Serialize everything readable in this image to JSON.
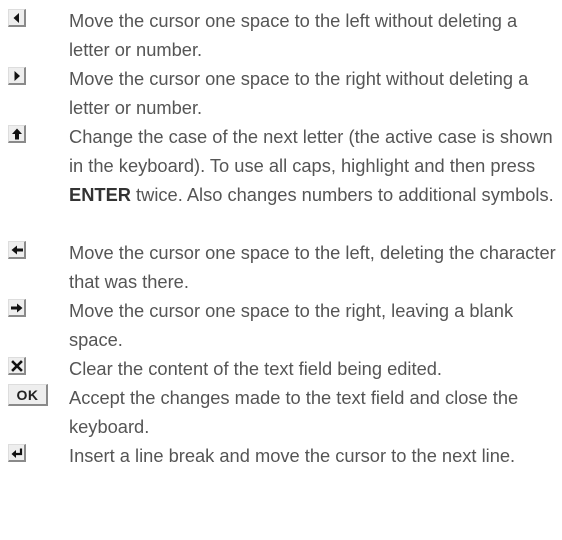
{
  "items": [
    {
      "icon": "left-triangle-icon",
      "text": "Move the cursor one space to the left without deleting a letter or number."
    },
    {
      "icon": "right-triangle-icon",
      "text": "Move the cursor one space to the right without deleting a letter or number."
    },
    {
      "icon": "shift-up-arrow-icon",
      "text_before": "Change the case of the next letter (the active case is shown in the keyboard). To use all caps, highlight and then press ",
      "emphasis": "ENTER",
      "text_after": " twice. Also changes numbers to additional symbols."
    },
    {
      "icon": "backspace-arrow-icon",
      "text": "Move the cursor one space to the left, deleting the character that was there."
    },
    {
      "icon": "space-arrow-icon",
      "text": "Move the cursor one space to the right, leaving a blank space."
    },
    {
      "icon": "clear-x-icon",
      "text": "Clear the content of the text field being edited."
    },
    {
      "icon": "ok-key-icon",
      "key_label": "OK",
      "text": "Accept the changes made to the text field and close the keyboard."
    },
    {
      "icon": "line-break-icon",
      "text": "Insert a line break and move the cursor to the next line."
    }
  ],
  "colors": {
    "text": "#555555",
    "key_face": "#eeeeee",
    "key_shadow": "#8a8a8a",
    "icon": "#111111"
  }
}
